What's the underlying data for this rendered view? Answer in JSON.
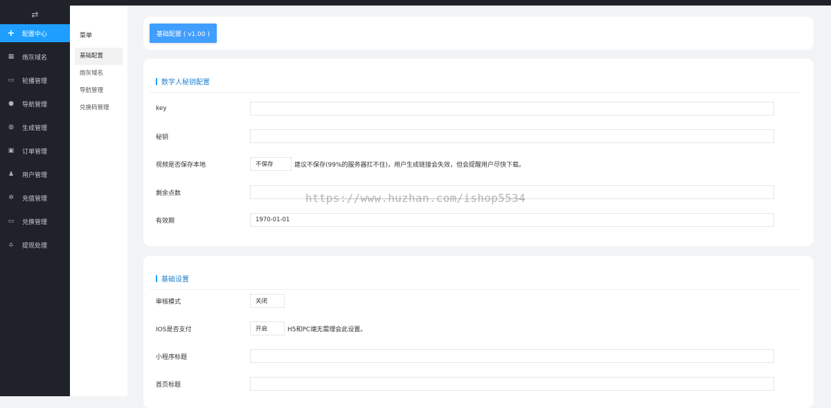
{
  "sidebar": {
    "toggle_icon": "swap-arrows-icon",
    "items": [
      {
        "label": "配置中心",
        "icon": "plus-icon",
        "active": true
      },
      {
        "label": "炮灰域名",
        "icon": "grid-icon"
      },
      {
        "label": "轮播管理",
        "icon": "card-icon"
      },
      {
        "label": "导航管理",
        "icon": "user-icon"
      },
      {
        "label": "生成管理",
        "icon": "globe-icon"
      },
      {
        "label": "订单管理",
        "icon": "ticket-icon"
      },
      {
        "label": "用户管理",
        "icon": "users-icon"
      },
      {
        "label": "充值管理",
        "icon": "gear-icon"
      },
      {
        "label": "兑换管理",
        "icon": "card-icon"
      },
      {
        "label": "提现处理",
        "icon": "home-icon"
      }
    ]
  },
  "submenu": {
    "title": "菜单",
    "items": [
      "基础配置",
      "炮灰域名",
      "导航管理",
      "兑换码管理"
    ]
  },
  "header": {
    "version_button": "基础配置 ( v1.00 )"
  },
  "key_section": {
    "title": "数字人秘钥配置",
    "key_label": "key",
    "key_value": "",
    "secret_label": "秘钥",
    "secret_value": "",
    "save_video_label": "视频是否保存本地",
    "save_video_value": "不保存",
    "save_video_hint": "建议不保存(99%的服务器扛不住)，用户生成链接会失效，但会提醒用户尽快下载。",
    "points_label": "剩余点数",
    "points_value": "",
    "expiry_label": "有效期",
    "expiry_value": "1970-01-01"
  },
  "base_section": {
    "title": "基础设置",
    "review_label": "审核模式",
    "review_value": "关闭",
    "ios_pay_label": "IOS是否支付",
    "ios_pay_value": "开启",
    "ios_pay_hint": "H5和PC端无需理会此设置。",
    "mini_title_label": "小程序标题",
    "mini_title_value": "",
    "home_title_label": "首页标题",
    "home_title_value": ""
  },
  "watermark": "https://www.huzhan.com/ishop5534",
  "colors": {
    "accent": "#1e9fff",
    "sidebar_bg": "#20222a",
    "button_bg": "#409eff"
  }
}
